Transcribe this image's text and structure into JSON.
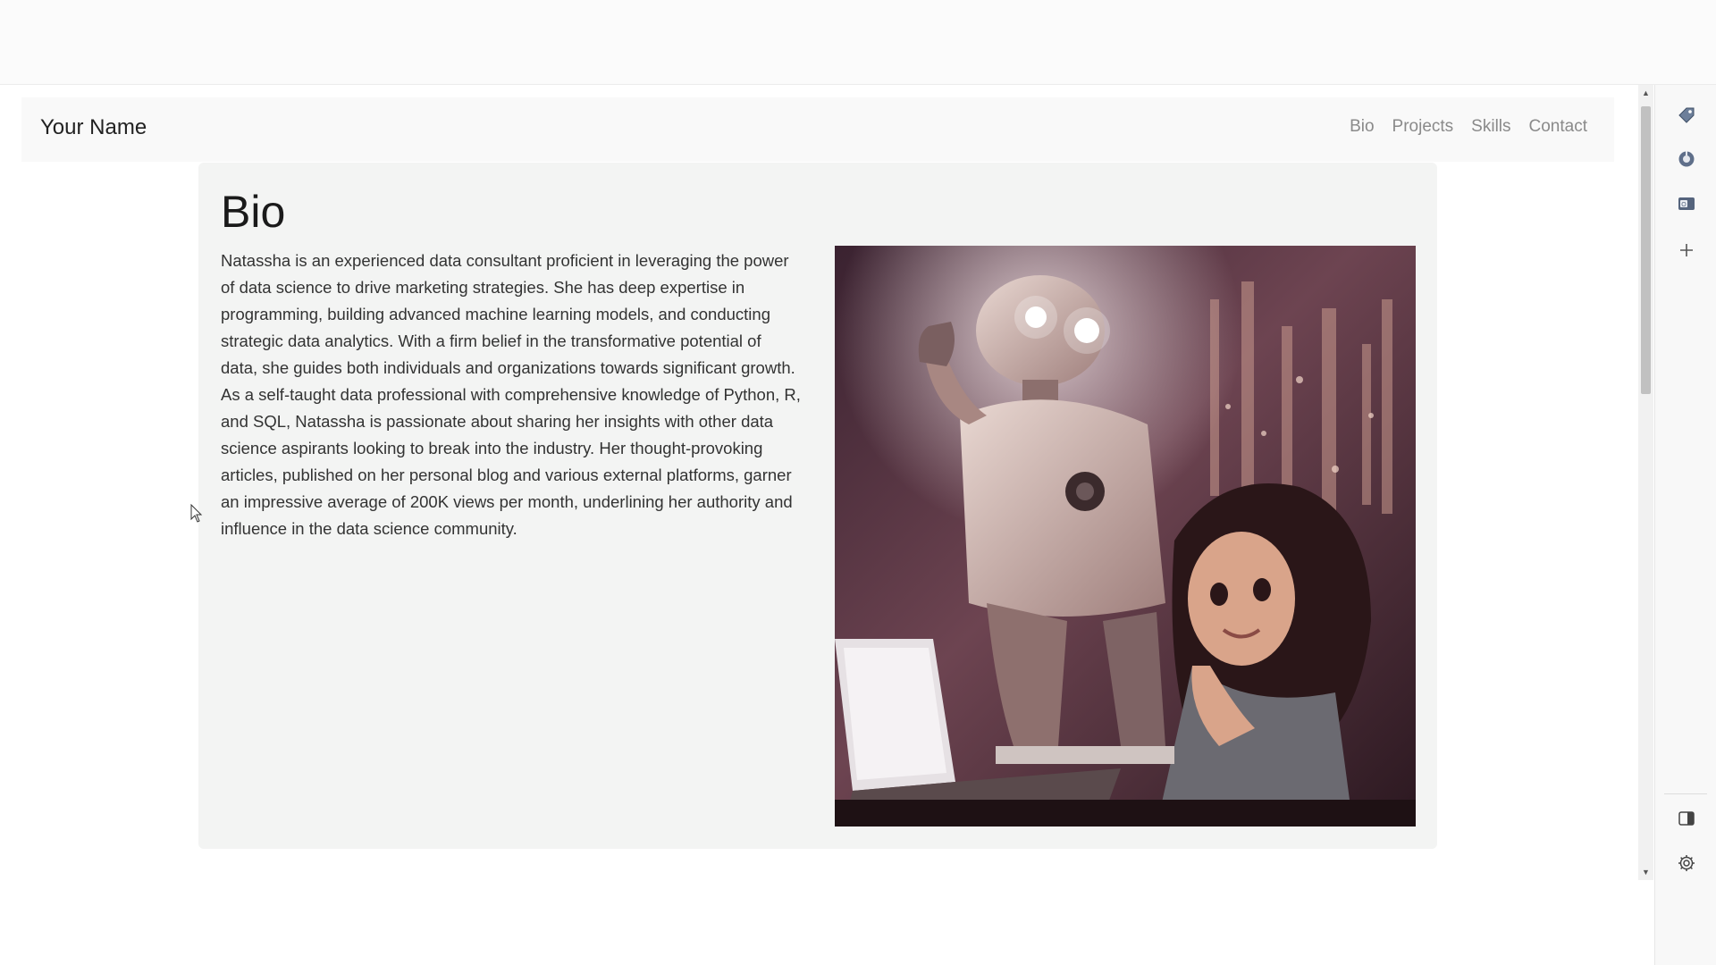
{
  "navbar": {
    "brand": "Your Name",
    "links": [
      "Bio",
      "Projects",
      "Skills",
      "Contact"
    ]
  },
  "bio": {
    "heading": "Bio",
    "paragraph": "Natassha is an experienced data consultant proficient in leveraging the power of data science to drive marketing strategies. She has deep expertise in programming, building advanced machine learning models, and conducting strategic data analytics. With a firm belief in the transformative potential of data, she guides both individuals and organizations towards significant growth. As a self-taught data professional with comprehensive knowledge of Python, R, and SQL, Natassha is passionate about sharing her insights with other data science aspirants looking to break into the industry. Her thought-provoking articles, published on her personal blog and various external platforms, garner an impressive average of 200K views per month, underlining her authority and influence in the data science community."
  },
  "sidebar": {
    "icons": [
      "tag-icon",
      "extension-icon",
      "outlook-icon",
      "add-icon",
      "split-screen-icon",
      "settings-icon"
    ]
  },
  "colors": {
    "section_bg": "#f3f4f3",
    "nav_link": "#8a8a8a",
    "text": "#333333"
  }
}
